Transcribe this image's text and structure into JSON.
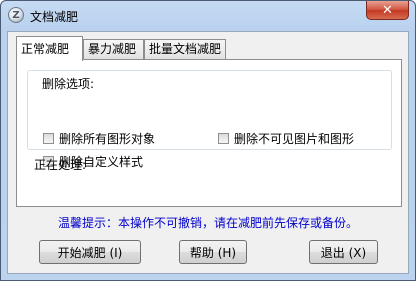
{
  "window": {
    "title": "文档减肥",
    "close_label": "✕"
  },
  "tabs": [
    {
      "label": "正常减肥"
    },
    {
      "label": "暴力减肥"
    },
    {
      "label": "批量文档减肥"
    }
  ],
  "delete_options": {
    "group_label": "删除选项:",
    "items": [
      {
        "label": "删除所有图形对象",
        "checked": false
      },
      {
        "label": "删除不可见图片和图形",
        "checked": false
      },
      {
        "label": "删除自定义样式",
        "checked": false
      }
    ]
  },
  "status": {
    "processing_label": "正在处理:"
  },
  "tip": "温馨提示：本操作不可撤销，请在减肥前先保存或备份。",
  "buttons": {
    "start": "开始减肥 (I)",
    "help": "帮助 (H)",
    "exit": "退出 (X)"
  },
  "colors": {
    "tip_text": "#0000cc",
    "close_button": "#c84a30"
  }
}
